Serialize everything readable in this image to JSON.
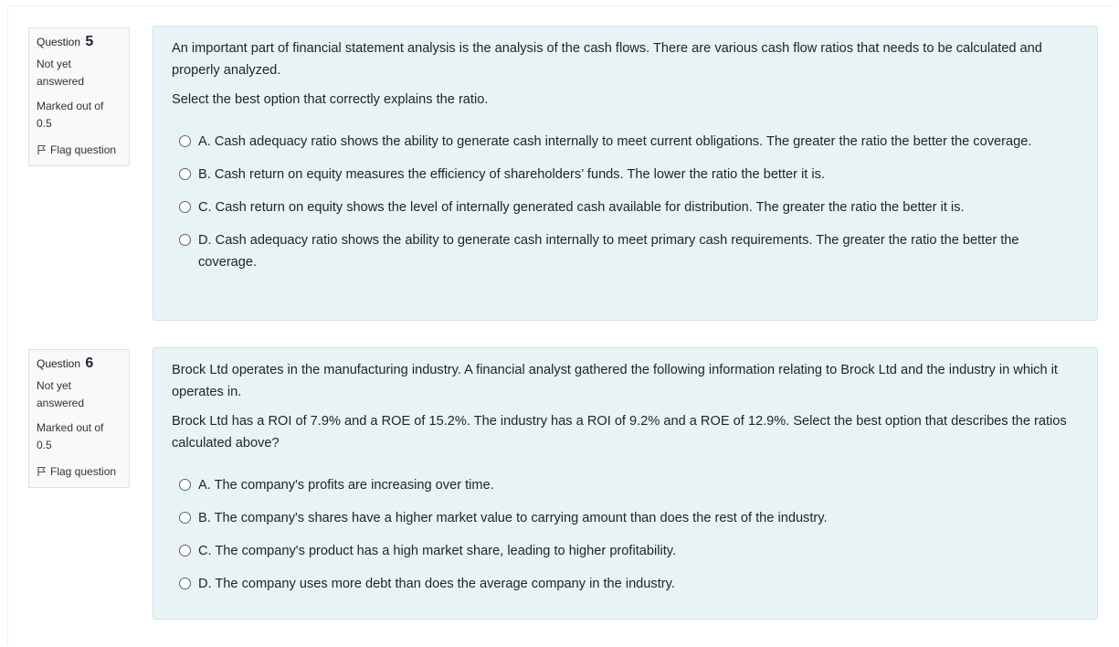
{
  "questions": [
    {
      "label": "Question",
      "number": "5",
      "state": "Not yet answered",
      "grade": "Marked out of 0.5",
      "flag_label": "Flag question",
      "text": [
        "An important part of financial statement analysis is the analysis of the cash flows. There are various cash flow ratios that needs to be calculated and properly analyzed.",
        "Select the best option that correctly explains the ratio."
      ],
      "options": [
        {
          "letter": "A.",
          "text": "Cash adequacy ratio shows the ability to generate cash internally to meet current obligations. The greater the ratio the better the coverage."
        },
        {
          "letter": "B.",
          "text": "Cash return on equity measures the efficiency of shareholders’ funds. The lower the ratio the better it is."
        },
        {
          "letter": "C.",
          "text": "Cash return on equity shows the level of internally generated cash available for distribution. The greater the ratio the better it is."
        },
        {
          "letter": "D.",
          "text": "Cash adequacy ratio shows the ability to generate cash internally to meet primary cash requirements. The greater the ratio the better the coverage."
        }
      ]
    },
    {
      "label": "Question",
      "number": "6",
      "state": "Not yet answered",
      "grade": "Marked out of 0.5",
      "flag_label": "Flag question",
      "text": [
        "Brock Ltd operates in the manufacturing industry. A financial analyst gathered the following information relating to Brock Ltd and the industry in which it operates in.",
        "Brock Ltd has a ROI of 7.9% and a ROE of 15.2%. The industry has a ROI of 9.2% and a ROE of 12.9%. Select the best option that describes the ratios calculated above?"
      ],
      "options": [
        {
          "letter": "A.",
          "text": "The company's profits are increasing over time."
        },
        {
          "letter": "B.",
          "text": "The company's shares have a higher market value to carrying amount than does the rest of the industry."
        },
        {
          "letter": "C.",
          "text": "The company's product has a high market share, leading to higher profitability."
        },
        {
          "letter": "D.",
          "text": "The company uses more debt than does the average company in the industry."
        }
      ]
    }
  ]
}
